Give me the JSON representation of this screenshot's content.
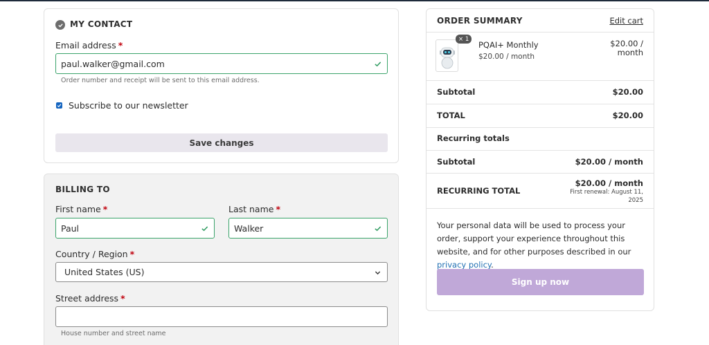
{
  "contact": {
    "title": "MY CONTACT",
    "email_label": "Email address",
    "required_mark": "*",
    "email_value": "paul.walker@gmail.com",
    "email_hint": "Order number and receipt will be sent to this email address.",
    "newsletter_label": "Subscribe to our newsletter",
    "newsletter_checked": true,
    "save_label": "Save changes"
  },
  "billing": {
    "title": "BILLING TO",
    "first_name_label": "First name",
    "first_name_value": "Paul",
    "last_name_label": "Last name",
    "last_name_value": "Walker",
    "country_label": "Country / Region",
    "country_value": "United States (US)",
    "street_label": "Street address",
    "street_value": "",
    "street_hint": "House number and street name"
  },
  "summary": {
    "title": "ORDER SUMMARY",
    "edit_label": "Edit cart",
    "item": {
      "qty": "× 1",
      "name": "PQAI+ Monthly",
      "sub_price": "$20.00 / month",
      "price": "$20.00 / month"
    },
    "subtotal_label": "Subtotal",
    "subtotal_value": "$20.00",
    "total_label": "TOTAL",
    "total_value": "$20.00",
    "recurring_heading": "Recurring totals",
    "recurring_subtotal_label": "Subtotal",
    "recurring_subtotal_value": "$20.00 / month",
    "recurring_total_label": "RECURRING TOTAL",
    "recurring_total_value": "$20.00",
    "recurring_total_unit": " / month",
    "renewal_text": "First renewal: August 11, 2025",
    "policy_text": "Your personal data will be used to process your order, support your experience throughout this website, and for other purposes described in our ",
    "policy_link": "privacy policy",
    "policy_end": ".",
    "signup_label": "Sign up now"
  },
  "colors": {
    "valid_border": "#3aa36a",
    "signup_button": "#c0a8d8",
    "link": "#1f6fb2",
    "required": "#c0000c"
  }
}
